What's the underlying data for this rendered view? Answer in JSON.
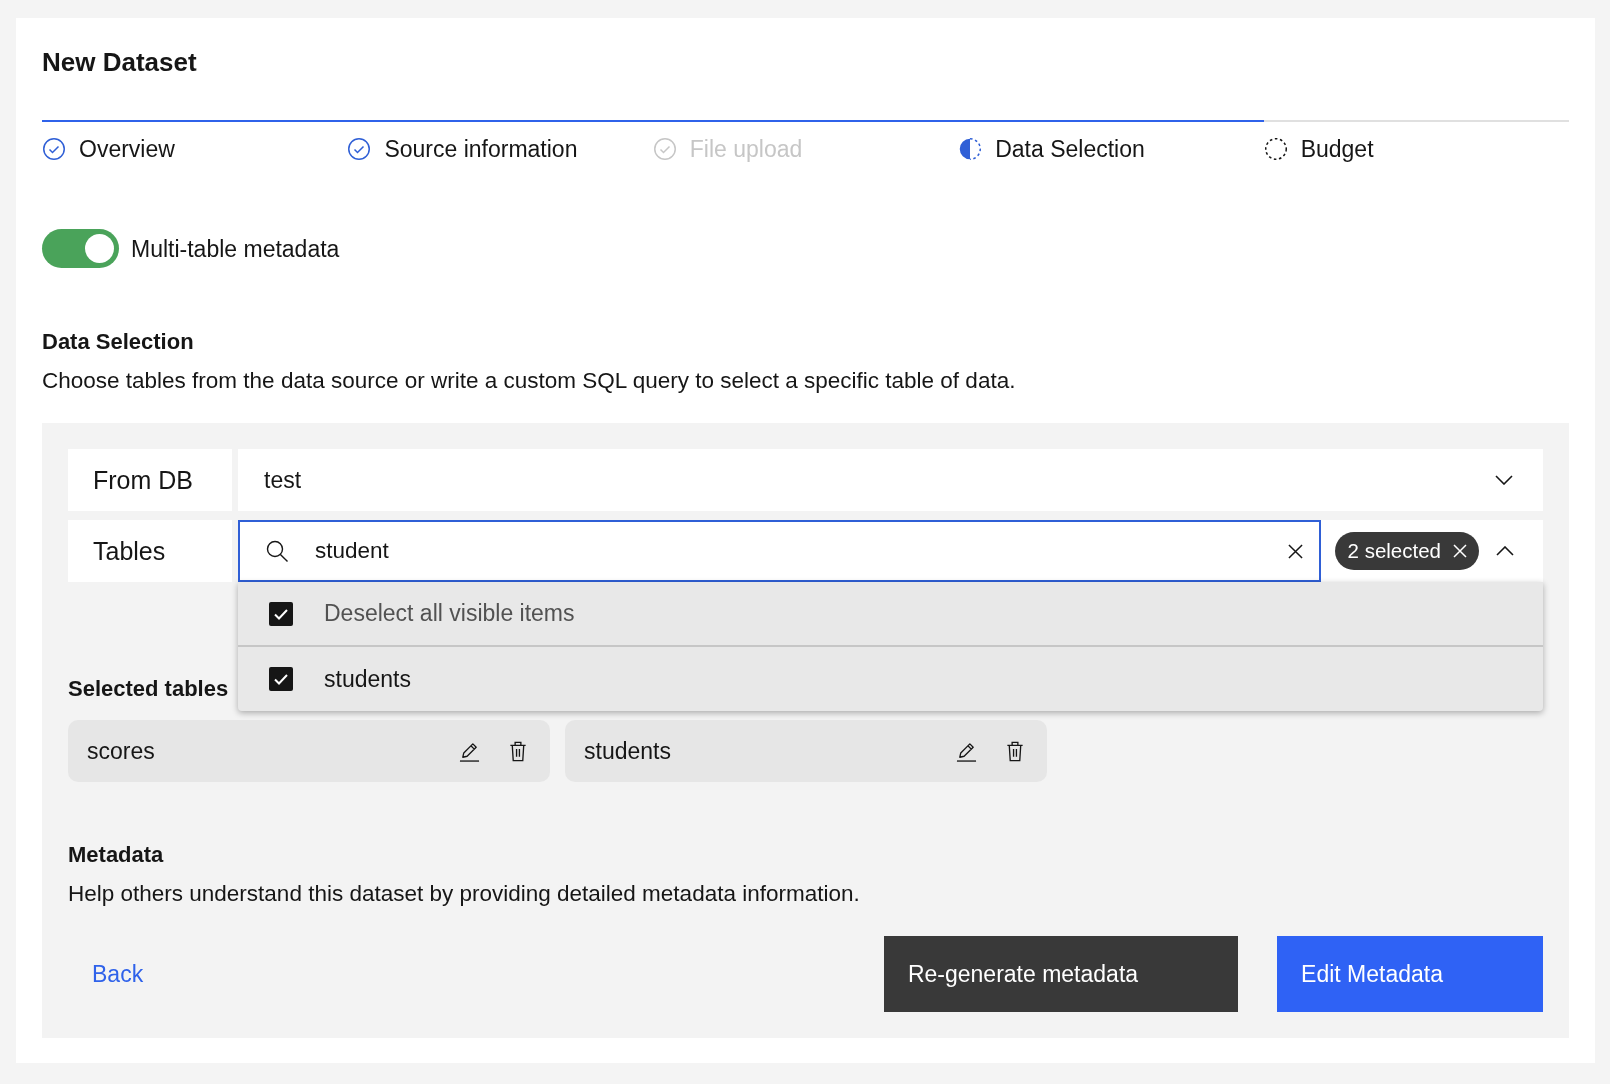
{
  "title": "New Dataset",
  "steps": [
    {
      "label": "Overview",
      "complete": true,
      "disabled": false,
      "selected": false
    },
    {
      "label": "Source information",
      "complete": true,
      "disabled": false,
      "selected": false
    },
    {
      "label": "File upload",
      "complete": true,
      "disabled": true,
      "selected": false
    },
    {
      "label": "Data Selection",
      "complete": false,
      "disabled": false,
      "selected": true
    },
    {
      "label": "Budget",
      "complete": false,
      "disabled": false,
      "selected": false
    }
  ],
  "toggle": {
    "label": "Multi-table metadata",
    "on": true
  },
  "data_selection": {
    "heading": "Data Selection",
    "description": "Choose tables from the data source or write a custom SQL query to select a specific table of data."
  },
  "form": {
    "from_db": {
      "label": "From DB",
      "value": "test"
    },
    "tables": {
      "label": "Tables",
      "value": "student",
      "tag": "2 selected",
      "expanded": true,
      "options": [
        {
          "label": "Deselect all visible items",
          "kind": "bulk",
          "checked": true
        },
        {
          "label": "students",
          "kind": "item",
          "checked": true
        }
      ]
    }
  },
  "selected_tables": {
    "heading": "Selected tables",
    "items": [
      {
        "name": "scores"
      },
      {
        "name": "students"
      }
    ]
  },
  "metadata": {
    "heading": "Metadata",
    "description": "Help others understand this dataset by providing detailed metadata information."
  },
  "actions": [
    {
      "label": "Back",
      "kind": "ghost"
    },
    {
      "label": "Re-generate metadata",
      "kind": "secondary"
    },
    {
      "label": "Edit Metadata",
      "kind": "primary"
    }
  ]
}
